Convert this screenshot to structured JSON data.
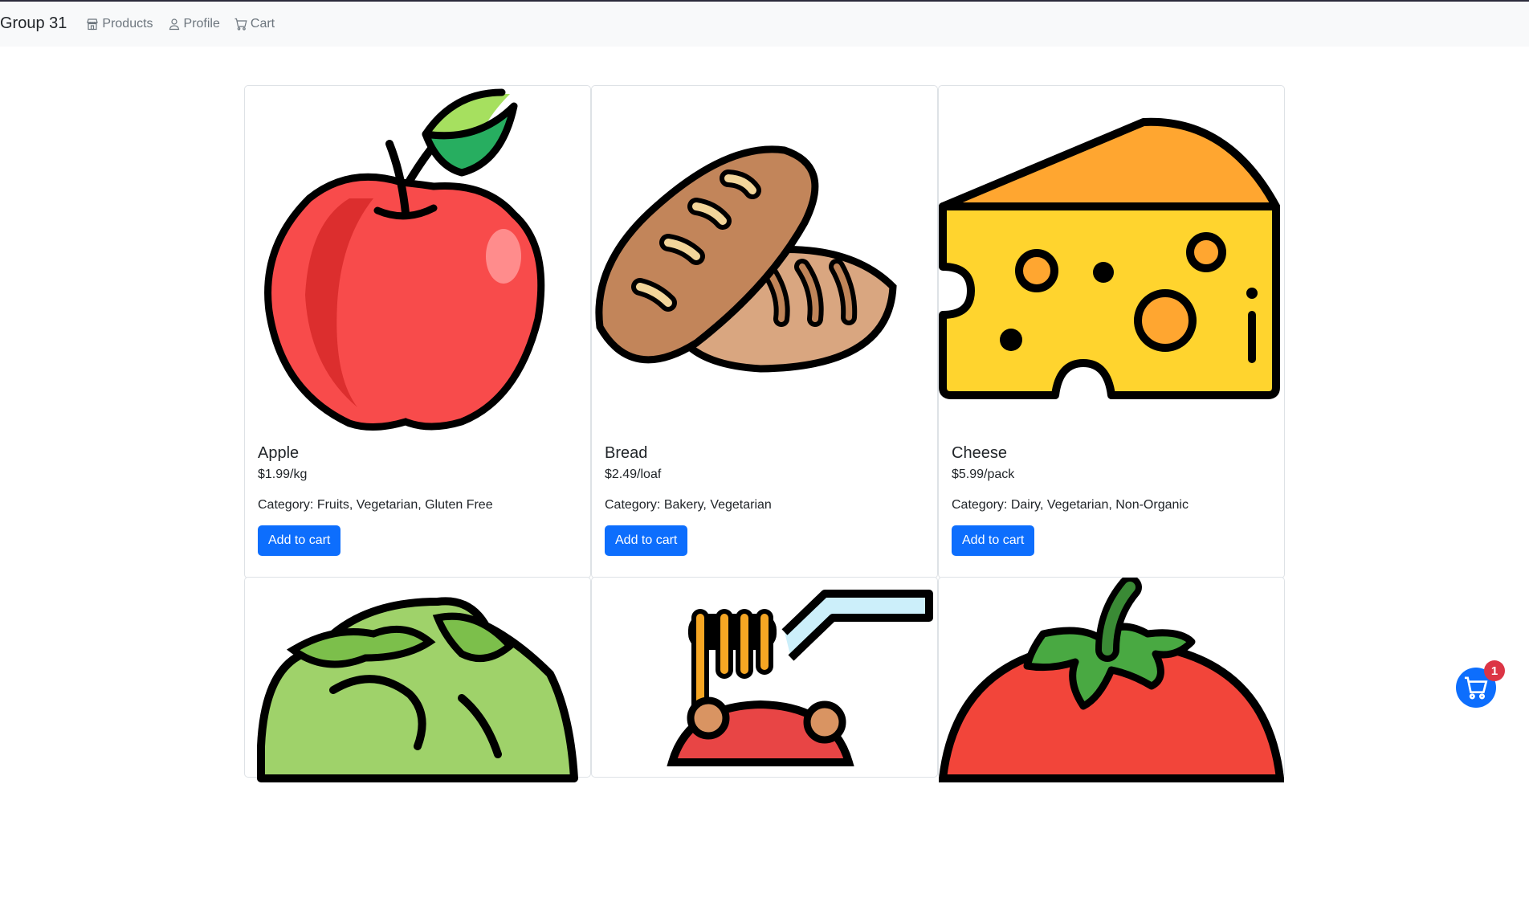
{
  "navbar": {
    "brand": "Group 31",
    "links": [
      {
        "label": "Products",
        "icon": "shop-icon"
      },
      {
        "label": "Profile",
        "icon": "person-icon"
      },
      {
        "label": "Cart",
        "icon": "cart-icon"
      }
    ]
  },
  "products": [
    {
      "name": "Apple",
      "price": "$1.99/kg",
      "category": "Category: Fruits, Vegetarian, Gluten Free",
      "button": "Add to cart",
      "icon": "apple-image"
    },
    {
      "name": "Bread",
      "price": "$2.49/loaf",
      "category": "Category: Bakery, Vegetarian",
      "button": "Add to cart",
      "icon": "bread-image"
    },
    {
      "name": "Cheese",
      "price": "$5.99/pack",
      "category": "Category: Dairy, Vegetarian, Non-Organic",
      "button": "Add to cart",
      "icon": "cheese-image"
    },
    {
      "icon": "lettuce-image"
    },
    {
      "icon": "spaghetti-image"
    },
    {
      "icon": "tomato-image"
    }
  ],
  "cart_fab": {
    "count": "1",
    "icon": "cart-icon"
  },
  "colors": {
    "primary": "#0d6efd",
    "badge": "#dc3545",
    "navbar_bg": "#f8f9fa"
  }
}
